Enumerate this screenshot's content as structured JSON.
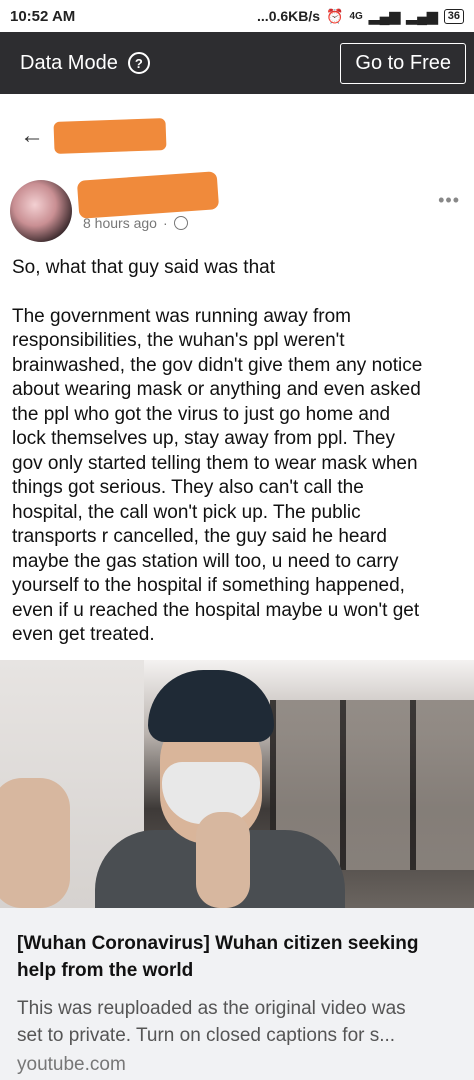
{
  "status_bar": {
    "time": "10:52 AM",
    "speed": "...0.6KB/s",
    "network": "4G",
    "battery": "36"
  },
  "data_mode_bar": {
    "label": "Data Mode",
    "help_symbol": "?",
    "button_label": "Go to Free"
  },
  "post": {
    "time_ago": "8 hours ago",
    "visibility_icon": "globe-icon",
    "more_icon": "more-icon",
    "paragraph1": "So, what that guy said was that",
    "paragraph2_lines": [
      "The government was running away from",
      "responsibilities, the wuhan's ppl weren't",
      "brainwashed, the gov didn't give them any notice",
      "about wearing mask or anything and even asked",
      "the ppl who got the virus to just go home and",
      "lock themselves up, stay away from ppl. They",
      "gov only started telling them to wear mask when",
      "things got serious. They also can't call the",
      "hospital, the call won't pick up. The public",
      "transports r cancelled, the guy said he heard",
      "maybe the gas station will too, u need to carry",
      "yourself to the hospital if something happened,",
      "even if u reached the hospital maybe u won't get",
      "even get treated."
    ]
  },
  "link": {
    "title_line1": "[Wuhan Coronavirus] Wuhan citizen seeking",
    "title_line2": "help from the world",
    "desc_line1": "This was reuploaded as the original video was",
    "desc_line2": "set to private. Turn on closed captions for s...",
    "domain": "youtube.com"
  }
}
